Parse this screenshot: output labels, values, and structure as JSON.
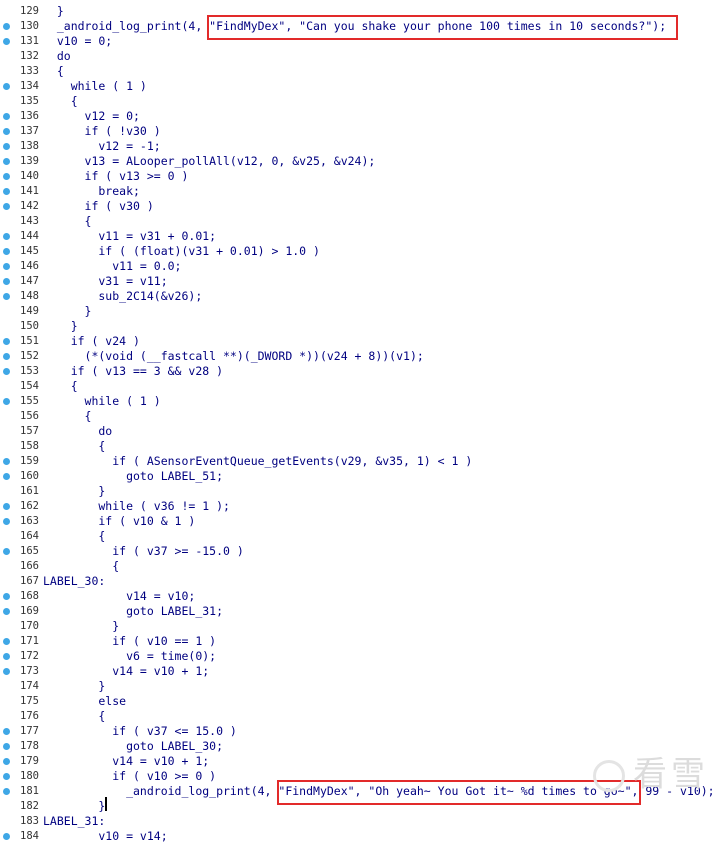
{
  "code_lines": [
    {
      "num": "129",
      "dot": false,
      "text": "  }"
    },
    {
      "num": "130",
      "dot": true,
      "text": "  _android_log_print(4, \"FindMyDex\", \"Can you shake your phone 100 times in 10 seconds?\");"
    },
    {
      "num": "131",
      "dot": true,
      "text": "  v10 = 0;"
    },
    {
      "num": "132",
      "dot": false,
      "text": "  do"
    },
    {
      "num": "133",
      "dot": false,
      "text": "  {"
    },
    {
      "num": "134",
      "dot": true,
      "text": "    while ( 1 )"
    },
    {
      "num": "135",
      "dot": false,
      "text": "    {"
    },
    {
      "num": "136",
      "dot": true,
      "text": "      v12 = 0;"
    },
    {
      "num": "137",
      "dot": true,
      "text": "      if ( !v30 )"
    },
    {
      "num": "138",
      "dot": true,
      "text": "        v12 = -1;"
    },
    {
      "num": "139",
      "dot": true,
      "text": "      v13 = ALooper_pollAll(v12, 0, &v25, &v24);"
    },
    {
      "num": "140",
      "dot": true,
      "text": "      if ( v13 >= 0 )"
    },
    {
      "num": "141",
      "dot": true,
      "text": "        break;"
    },
    {
      "num": "142",
      "dot": true,
      "text": "      if ( v30 )"
    },
    {
      "num": "143",
      "dot": false,
      "text": "      {"
    },
    {
      "num": "144",
      "dot": true,
      "text": "        v11 = v31 + 0.01;"
    },
    {
      "num": "145",
      "dot": true,
      "text": "        if ( (float)(v31 + 0.01) > 1.0 )"
    },
    {
      "num": "146",
      "dot": true,
      "text": "          v11 = 0.0;"
    },
    {
      "num": "147",
      "dot": true,
      "text": "        v31 = v11;"
    },
    {
      "num": "148",
      "dot": true,
      "text": "        sub_2C14(&v26);"
    },
    {
      "num": "149",
      "dot": false,
      "text": "      }"
    },
    {
      "num": "150",
      "dot": false,
      "text": "    }"
    },
    {
      "num": "151",
      "dot": true,
      "text": "    if ( v24 )"
    },
    {
      "num": "152",
      "dot": true,
      "text": "      (*(void (__fastcall **)(_DWORD *))(v24 + 8))(v1);"
    },
    {
      "num": "153",
      "dot": true,
      "text": "    if ( v13 == 3 && v28 )"
    },
    {
      "num": "154",
      "dot": false,
      "text": "    {"
    },
    {
      "num": "155",
      "dot": true,
      "text": "      while ( 1 )"
    },
    {
      "num": "156",
      "dot": false,
      "text": "      {"
    },
    {
      "num": "157",
      "dot": false,
      "text": "        do"
    },
    {
      "num": "158",
      "dot": false,
      "text": "        {"
    },
    {
      "num": "159",
      "dot": true,
      "text": "          if ( ASensorEventQueue_getEvents(v29, &v35, 1) < 1 )"
    },
    {
      "num": "160",
      "dot": true,
      "text": "            goto LABEL_51;"
    },
    {
      "num": "161",
      "dot": false,
      "text": "        }"
    },
    {
      "num": "162",
      "dot": true,
      "text": "        while ( v36 != 1 );"
    },
    {
      "num": "163",
      "dot": true,
      "text": "        if ( v10 & 1 )"
    },
    {
      "num": "164",
      "dot": false,
      "text": "        {"
    },
    {
      "num": "165",
      "dot": true,
      "text": "          if ( v37 >= -15.0 )"
    },
    {
      "num": "166",
      "dot": false,
      "text": "          {"
    },
    {
      "num": "167",
      "dot": false,
      "text": "LABEL_30:"
    },
    {
      "num": "168",
      "dot": true,
      "text": "            v14 = v10;"
    },
    {
      "num": "169",
      "dot": true,
      "text": "            goto LABEL_31;"
    },
    {
      "num": "170",
      "dot": false,
      "text": "          }"
    },
    {
      "num": "171",
      "dot": true,
      "text": "          if ( v10 == 1 )"
    },
    {
      "num": "172",
      "dot": true,
      "text": "            v6 = time(0);"
    },
    {
      "num": "173",
      "dot": true,
      "text": "          v14 = v10 + 1;"
    },
    {
      "num": "174",
      "dot": false,
      "text": "        }"
    },
    {
      "num": "175",
      "dot": false,
      "text": "        else"
    },
    {
      "num": "176",
      "dot": false,
      "text": "        {"
    },
    {
      "num": "177",
      "dot": true,
      "text": "          if ( v37 <= 15.0 )"
    },
    {
      "num": "178",
      "dot": true,
      "text": "            goto LABEL_30;"
    },
    {
      "num": "179",
      "dot": true,
      "text": "          v14 = v10 + 1;"
    },
    {
      "num": "180",
      "dot": true,
      "text": "          if ( v10 >= 0 )"
    },
    {
      "num": "181",
      "dot": true,
      "text": "            _android_log_print(4, \"FindMyDex\", \"Oh yeah~ You Got it~ %d times to go~\", 99 - v10);"
    },
    {
      "num": "182",
      "dot": false,
      "text": "        }"
    },
    {
      "num": "183",
      "dot": false,
      "text": "LABEL_31:"
    },
    {
      "num": "184",
      "dot": true,
      "text": "        v10 = v14;"
    }
  ],
  "watermark": {
    "text": "看雪"
  },
  "colors": {
    "code": "#000080",
    "dot": "#3ea7e6",
    "highlight_box": "#e22a2a"
  }
}
